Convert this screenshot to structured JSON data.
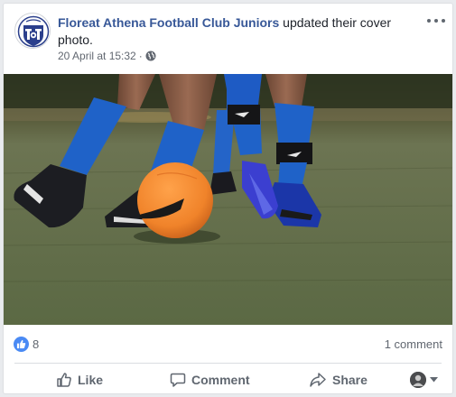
{
  "post": {
    "page_name": "Floreat Athena Football Club Juniors",
    "action_text": " updated their cover photo.",
    "date": "20 April at 15:32",
    "separator": "·",
    "privacy_icon": "globe-icon"
  },
  "stats": {
    "reaction_icon": "thumbs-up-icon",
    "like_count": "8",
    "comments": "1 comment"
  },
  "actions": {
    "like": "Like",
    "comment": "Comment",
    "share": "Share"
  },
  "colors": {
    "brand_blue": "#385898",
    "like_blue": "#4a8af4",
    "ball_orange": "#f08a2e",
    "sock_blue": "#1f62c8",
    "grass": "#5c6b44"
  }
}
